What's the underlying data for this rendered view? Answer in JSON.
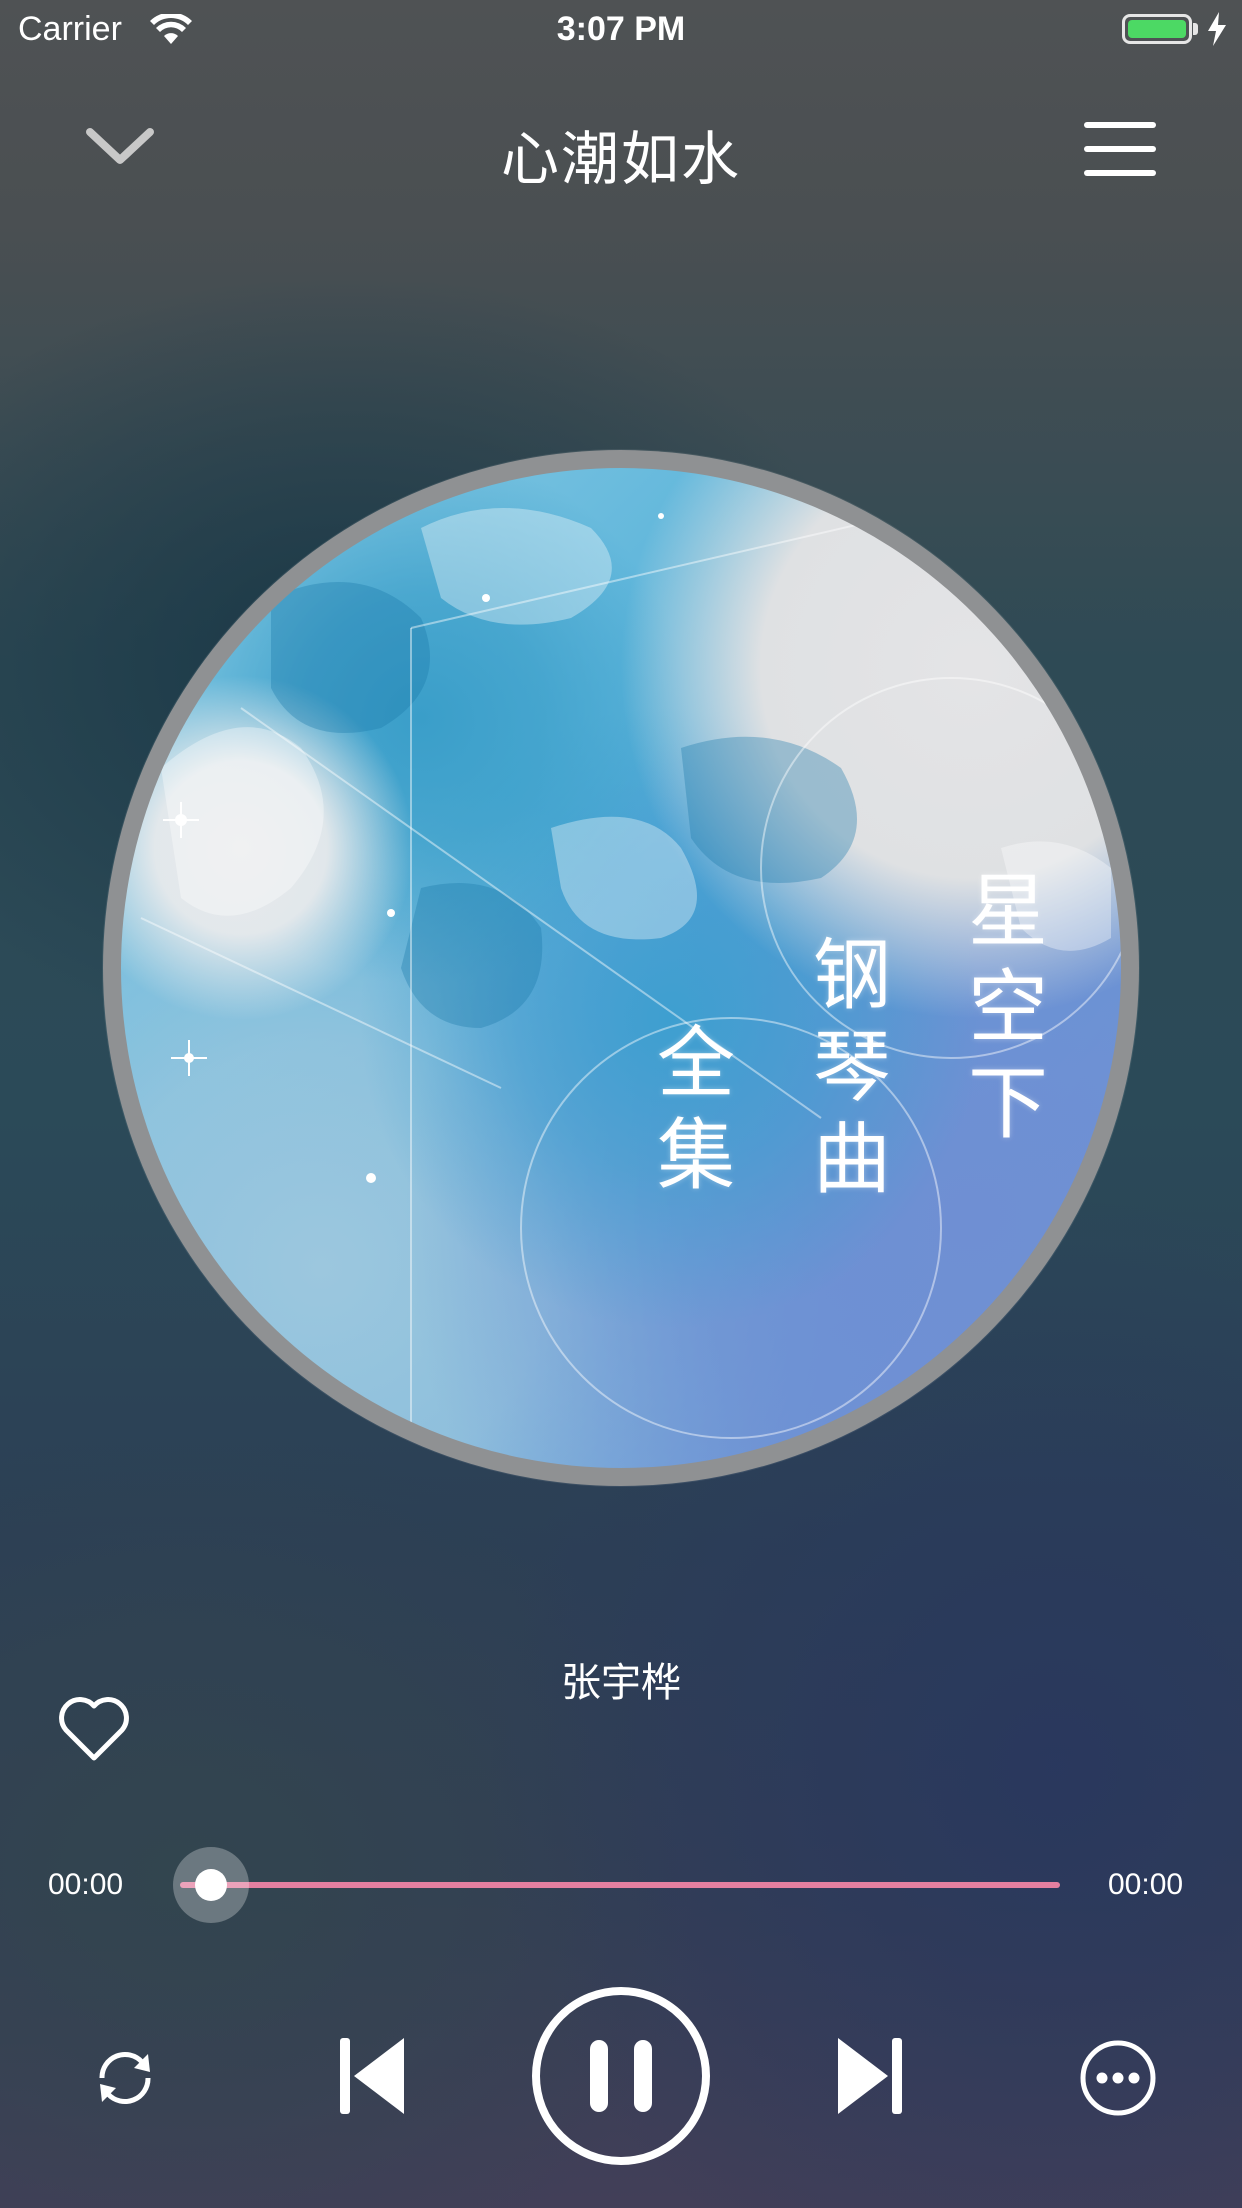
{
  "status_bar": {
    "carrier": "Carrier",
    "time": "3:07 PM",
    "battery_color": "#4cd964"
  },
  "nav": {
    "back_icon": "chevron-down-icon",
    "title": "心潮如水",
    "menu_icon": "hamburger-menu-icon"
  },
  "album_cover": {
    "title_line1": [
      "星",
      "空",
      "下"
    ],
    "title_line2": [
      "钢",
      "琴",
      "曲"
    ],
    "title_line3": [
      "全",
      "集"
    ]
  },
  "track_info": {
    "artist": "张宇桦",
    "favorite_icon": "heart-outline-icon"
  },
  "progress": {
    "current_time": "00:00",
    "total_time": "00:00",
    "fraction": 0,
    "track_color": "#e47fa0"
  },
  "controls": {
    "loop_icon": "repeat-icon",
    "prev_icon": "skip-previous-icon",
    "play_pause_icon": "pause-icon",
    "next_icon": "skip-next-icon",
    "more_icon": "more-options-icon"
  }
}
